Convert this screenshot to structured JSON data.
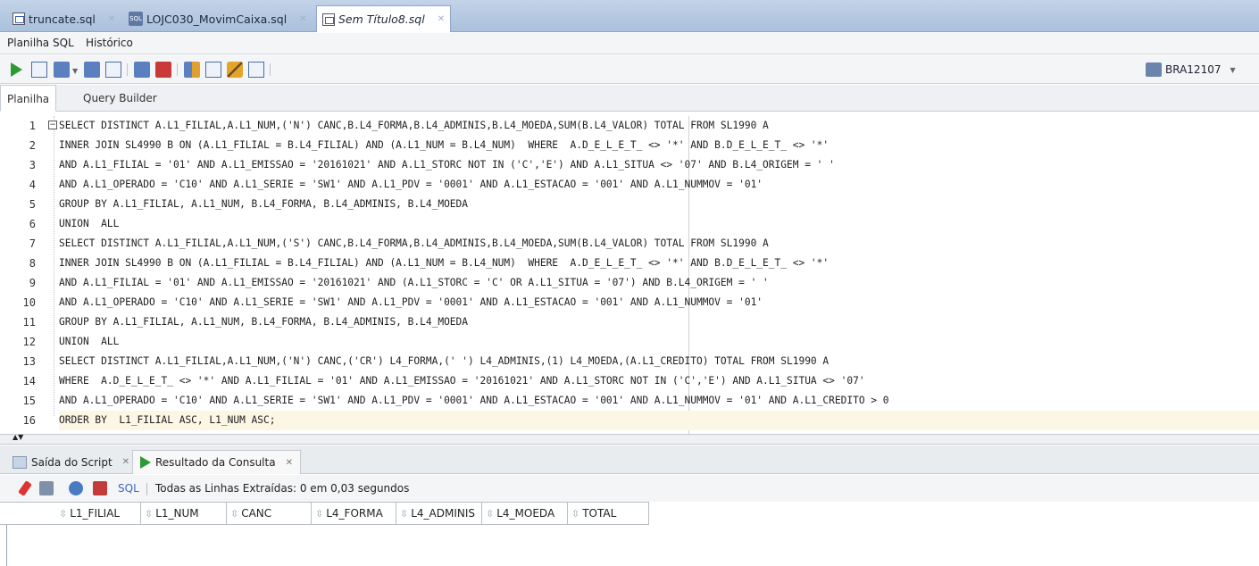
{
  "file_tabs": [
    {
      "label": "truncate.sql",
      "icon": "sql-file-icon"
    },
    {
      "label": "LOJC030_MovimCaixa.sql",
      "icon": "db-file-icon"
    },
    {
      "label": "Sem Título8.sql",
      "icon": "sql-file-icon",
      "active": true
    }
  ],
  "sub_tabs": [
    "Planilha SQL",
    "Histórico"
  ],
  "toolbar": {
    "connection": "BRA12107"
  },
  "editor_tabs": [
    "Planilha",
    "Query Builder"
  ],
  "code_lines": [
    {
      "n": "1",
      "text": "SELECT DISTINCT A.L1_FILIAL,A.L1_NUM,('N') CANC,B.L4_FORMA,B.L4_ADMINIS,B.L4_MOEDA,SUM(B.L4_VALOR) TOTAL FROM SL1990 A"
    },
    {
      "n": "2",
      "text": "INNER JOIN SL4990 B ON (A.L1_FILIAL = B.L4_FILIAL) AND (A.L1_NUM = B.L4_NUM)  WHERE  A.D_E_L_E_T_ <> '*' AND B.D_E_L_E_T_ <> '*'"
    },
    {
      "n": "3",
      "text": "AND A.L1_FILIAL = '01' AND A.L1_EMISSAO = '20161021' AND A.L1_STORC NOT IN ('C','E') AND A.L1_SITUA <> '07' AND B.L4_ORIGEM = ' '"
    },
    {
      "n": "4",
      "text": "AND A.L1_OPERADO = 'C10' AND A.L1_SERIE = 'SW1' AND A.L1_PDV = '0001' AND A.L1_ESTACAO = '001' AND A.L1_NUMMOV = '01'"
    },
    {
      "n": "5",
      "text": "GROUP BY A.L1_FILIAL, A.L1_NUM, B.L4_FORMA, B.L4_ADMINIS, B.L4_MOEDA"
    },
    {
      "n": "6",
      "text": "UNION  ALL"
    },
    {
      "n": "7",
      "text": "SELECT DISTINCT A.L1_FILIAL,A.L1_NUM,('S') CANC,B.L4_FORMA,B.L4_ADMINIS,B.L4_MOEDA,SUM(B.L4_VALOR) TOTAL FROM SL1990 A"
    },
    {
      "n": "8",
      "text": "INNER JOIN SL4990 B ON (A.L1_FILIAL = B.L4_FILIAL) AND (A.L1_NUM = B.L4_NUM)  WHERE  A.D_E_L_E_T_ <> '*' AND B.D_E_L_E_T_ <> '*'"
    },
    {
      "n": "9",
      "text": "AND A.L1_FILIAL = '01' AND A.L1_EMISSAO = '20161021' AND (A.L1_STORC = 'C' OR A.L1_SITUA = '07') AND B.L4_ORIGEM = ' '"
    },
    {
      "n": "10",
      "text": "AND A.L1_OPERADO = 'C10' AND A.L1_SERIE = 'SW1' AND A.L1_PDV = '0001' AND A.L1_ESTACAO = '001' AND A.L1_NUMMOV = '01'"
    },
    {
      "n": "11",
      "text": "GROUP BY A.L1_FILIAL, A.L1_NUM, B.L4_FORMA, B.L4_ADMINIS, B.L4_MOEDA"
    },
    {
      "n": "12",
      "text": "UNION  ALL"
    },
    {
      "n": "13",
      "text": "SELECT DISTINCT A.L1_FILIAL,A.L1_NUM,('N') CANC,('CR') L4_FORMA,(' ') L4_ADMINIS,(1) L4_MOEDA,(A.L1_CREDITO) TOTAL FROM SL1990 A"
    },
    {
      "n": "14",
      "text": "WHERE  A.D_E_L_E_T_ <> '*' AND A.L1_FILIAL = '01' AND A.L1_EMISSAO = '20161021' AND A.L1_STORC NOT IN ('C','E') AND A.L1_SITUA <> '07'"
    },
    {
      "n": "15",
      "text": "AND A.L1_OPERADO = 'C10' AND A.L1_SERIE = 'SW1' AND A.L1_PDV = '0001' AND A.L1_ESTACAO = '001' AND A.L1_NUMMOV = '01' AND A.L1_CREDITO > 0"
    },
    {
      "n": "16",
      "text": "ORDER BY  L1_FILIAL ASC, L1_NUM ASC;",
      "current": true
    }
  ],
  "output_tabs": [
    {
      "label": "Saída do Script",
      "icon": "script-output-icon"
    },
    {
      "label": "Resultado da Consulta",
      "icon": "run-query-icon",
      "active": true
    }
  ],
  "results": {
    "sql_label": "SQL",
    "status": "Todas as Linhas Extraídas: 0 em 0,03 segundos",
    "columns": [
      "L1_FILIAL",
      "L1_NUM",
      "CANC",
      "L4_FORMA",
      "L4_ADMINIS",
      "L4_MOEDA",
      "TOTAL"
    ]
  },
  "colors": {
    "tab_bar": "#aac0dc",
    "keyword": "#1f3ac8",
    "current_line": "#fcf6e4"
  }
}
